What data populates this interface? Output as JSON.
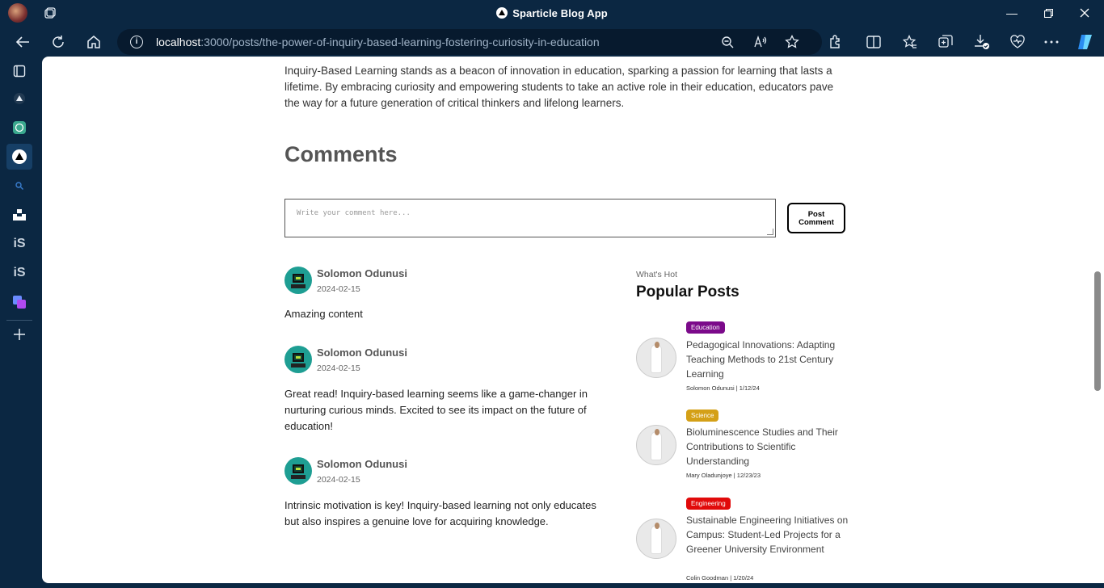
{
  "window": {
    "title": "Sparticle Blog App"
  },
  "address_bar": {
    "host": "localhost",
    "path": ":3000/posts/the-power-of-inquiry-based-learning-fostering-curiosity-in-education"
  },
  "article": {
    "closing_paragraph": "Inquiry-Based Learning stands as a beacon of innovation in education, sparking a passion for learning that lasts a lifetime. By embracing curiosity and empowering students to take an active role in their education, educators pave the way for a future generation of critical thinkers and lifelong learners."
  },
  "comments": {
    "heading": "Comments",
    "input_placeholder": "Write your comment here...",
    "post_button": "Post Comment",
    "items": [
      {
        "author": "Solomon Odunusi",
        "date": "2024-02-15",
        "text": "Amazing content"
      },
      {
        "author": "Solomon Odunusi",
        "date": "2024-02-15",
        "text": "Great read! Inquiry-based learning seems like a game-changer in nurturing curious minds. Excited to see its impact on the future of education!"
      },
      {
        "author": "Solomon Odunusi",
        "date": "2024-02-15",
        "text": "Intrinsic motivation is key! Inquiry-based learning not only educates but also inspires a genuine love for acquiring knowledge."
      }
    ]
  },
  "popular": {
    "kicker": "What's Hot",
    "heading": "Popular Posts",
    "posts": [
      {
        "category": "Education",
        "category_color": "#7b0a8a",
        "title": "Pedagogical Innovations: Adapting Teaching Methods to 21st Century Learning",
        "meta": "Solomon Odunusi | 1/12/24"
      },
      {
        "category": "Science",
        "category_color": "#d4a017",
        "title": "Bioluminescence Studies and Their Contributions to Scientific Understanding",
        "meta": "Mary Oladunjoye | 12/23/23"
      },
      {
        "category": "Engineering",
        "category_color": "#e10a0a",
        "title": "Sustainable Engineering Initiatives on Campus: Student-Led Projects for a Greener University Environment",
        "meta": "Colin Goodman | 1/20/24"
      }
    ]
  }
}
